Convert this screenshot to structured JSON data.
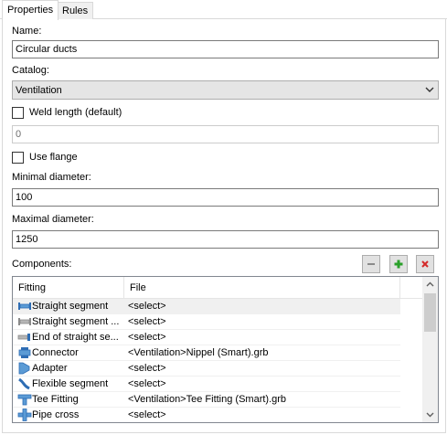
{
  "tabs": [
    {
      "label": "Properties",
      "active": true
    },
    {
      "label": "Rules",
      "active": false
    }
  ],
  "form": {
    "name_label": "Name:",
    "name_value": "Circular ducts",
    "catalog_label": "Catalog:",
    "catalog_value": "Ventilation",
    "weld_length_label": "Weld length (default)",
    "weld_length_checked": false,
    "weld_length_value": "0",
    "use_flange_label": "Use flange",
    "use_flange_checked": false,
    "min_diameter_label": "Minimal diameter:",
    "min_diameter_value": "100",
    "max_diameter_label": "Maximal diameter:",
    "max_diameter_value": "1250",
    "components_label": "Components:"
  },
  "components": {
    "columns": [
      "Fitting",
      "File"
    ],
    "rows": [
      {
        "fitting": "Straight segment",
        "file": "<select>",
        "icon": "straight-segment-icon",
        "selected": true
      },
      {
        "fitting": "Straight segment ...",
        "file": "<select>",
        "icon": "straight-segment-gray-icon",
        "selected": false
      },
      {
        "fitting": "End of straight se...",
        "file": "<select>",
        "icon": "end-straight-segment-icon",
        "selected": false
      },
      {
        "fitting": "Connector",
        "file": "<Ventilation>Nippel (Smart).grb",
        "icon": "connector-icon",
        "selected": false
      },
      {
        "fitting": "Adapter",
        "file": "<select>",
        "icon": "adapter-icon",
        "selected": false
      },
      {
        "fitting": "Flexible segment",
        "file": "<select>",
        "icon": "flexible-segment-icon",
        "selected": false
      },
      {
        "fitting": "Tee Fitting",
        "file": "<Ventilation>Tee Fitting (Smart).grb",
        "icon": "tee-fitting-icon",
        "selected": false
      },
      {
        "fitting": "Pipe cross",
        "file": "<select>",
        "icon": "pipe-cross-icon",
        "selected": false
      }
    ]
  },
  "colors": {
    "icon_blue": "#2e6db4",
    "icon_gray": "#9a9a9a",
    "add_green": "#2aa02a",
    "remove_red": "#d42a2a"
  }
}
